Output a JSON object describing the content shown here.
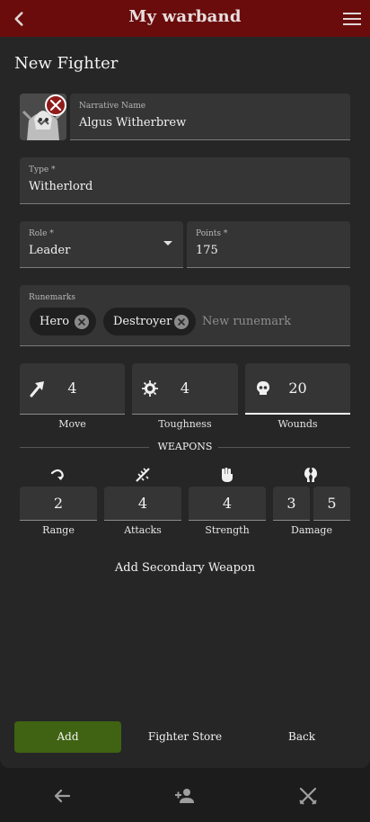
{
  "appbar": {
    "title": "My warband",
    "back_icon": "chevron-left-icon",
    "menu_icon": "hamburger-menu-icon"
  },
  "page": {
    "heading": "New Fighter"
  },
  "avatar": {
    "image": "fighter-portrait",
    "remove_icon": "close-icon"
  },
  "form": {
    "narrative_name": {
      "label": "Narrative Name",
      "value": "Algus Witherbrew"
    },
    "type": {
      "label": "Type *",
      "value": "Witherlord"
    },
    "role": {
      "label": "Role *",
      "value": "Leader"
    },
    "points": {
      "label": "Points *",
      "value": "175"
    },
    "runemarks": {
      "label": "Runemarks",
      "chips": [
        "Hero",
        "Destroyer"
      ],
      "placeholder": "New runemark"
    }
  },
  "stats": [
    {
      "label": "Move",
      "value": "4",
      "icon": "arrow-icon"
    },
    {
      "label": "Toughness",
      "value": "4",
      "icon": "shield-icon"
    },
    {
      "label": "Wounds",
      "value": "20",
      "icon": "skull-icon"
    }
  ],
  "weapons": {
    "heading": "WEAPONS",
    "range": {
      "label": "Range",
      "value": "2",
      "icon": "range-icon"
    },
    "attacks": {
      "label": "Attacks",
      "value": "4",
      "icon": "attacks-icon"
    },
    "strength": {
      "label": "Strength",
      "value": "4",
      "icon": "fist-icon"
    },
    "damage": {
      "label": "Damage",
      "value": "3",
      "crit": "5",
      "icon": "broken-skull-icon"
    },
    "add_secondary_label": "Add Secondary Weapon"
  },
  "actions": {
    "add_label": "Add",
    "store_label": "Fighter Store",
    "back_label": "Back"
  },
  "bottom_nav": {
    "icons": [
      "arrow-left-icon",
      "person-add-icon",
      "crossed-swords-icon"
    ]
  },
  "colors": {
    "appbar": "#6a0c0c",
    "panel": "#262626",
    "field": "#353535",
    "accent_green": "#3f6312",
    "remove_red": "#8f1b1b"
  }
}
